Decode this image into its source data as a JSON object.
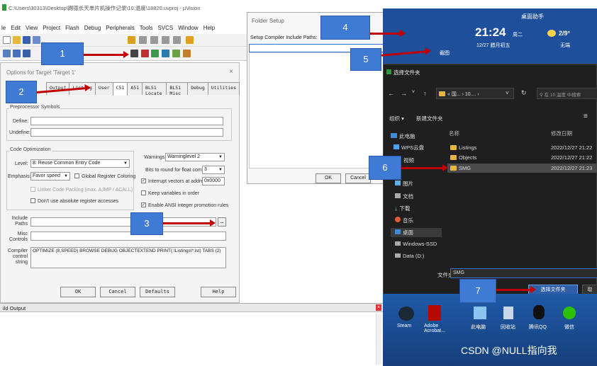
{
  "uvision": {
    "title": "C:\\Users\\30313\\Desktop\\踢德长天单片机操作记录\\10.温度\\18820.uvproj - µVision",
    "menu": [
      "le",
      "Edit",
      "View",
      "Project",
      "Flash",
      "Debug",
      "Peripherals",
      "Tools",
      "SVCS",
      "Window",
      "Help"
    ]
  },
  "options": {
    "title": "Options for Target 'Target 1'",
    "tabs": [
      "Output",
      "Listing",
      "User",
      "C51",
      "A51",
      "BL51 Locate",
      "BL51 Misc",
      "Debug",
      "Utilities"
    ],
    "preproc_label": "Preprocessor Symbols",
    "define_label": "Define:",
    "undefine_label": "Undefine:",
    "codeopt_label": "Code Optimization",
    "level_label": "Level:",
    "level_value": "8: Reuse Common Entry Code",
    "emphasis_label": "Emphasis:",
    "emphasis_value": "Favor speed",
    "global_reg": "Global Register Coloring",
    "linker_pack": "Linker Code Packing (max. AJMP / ACALL)",
    "no_abs": "Don't use absolute register accesses",
    "warnings_label": "Warnings:",
    "warnings_value": "Warninglevel 2",
    "bits_label": "Bits to round for float compare:",
    "bits_value": "3",
    "interrupt_label": "Interrupt vectors at address:",
    "interrupt_value": "0x0000",
    "keep_vars": "Keep variables in order",
    "ansi": "Enable ANSI integer promotion rules",
    "include_label": "Include Paths",
    "misc_label": "Misc Controls",
    "compiler_label": "Compiler control string",
    "compiler_value": "OPTIMIZE (8,SPEED) BROWSE DEBUG OBJECTEXTEND PRINT(.\\Listings\\*.lst) TABS (2)",
    "ok": "OK",
    "cancel": "Cancel",
    "defaults": "Defaults",
    "help": "Help"
  },
  "folder_setup": {
    "title": "Folder Setup",
    "question": "?",
    "close": "X",
    "paths_label": "Setup Compiler Include Paths:",
    "ok": "OK",
    "cancel": "Cancel"
  },
  "desktop": {
    "widget_title": "桌面助手",
    "time": "21:24",
    "weekday": "周二",
    "date": "12/27 腊月初五",
    "temp": "2/9°",
    "weather": "无端",
    "partial": "截图"
  },
  "file_chooser": {
    "title": "选择文件夹",
    "path": "« 国... › 10.... ›",
    "search": "在 10.温度 中搜索",
    "organize": "组织 ▾",
    "new_folder": "新建文件夹",
    "col_name": "名称",
    "col_date": "修改日期",
    "sidebar": [
      "此电脑",
      "WPS云盘",
      "视频",
      "图片",
      "文档",
      "下载",
      "音乐",
      "桌面",
      "Windows-SSD",
      "Data (D:)"
    ],
    "folders": [
      {
        "name": "Listings",
        "date": "2022/12/27 21:22"
      },
      {
        "name": "Objects",
        "date": "2022/12/27 21:22"
      },
      {
        "name": "SMG",
        "date": "2022/12/27 21:23"
      }
    ],
    "filename_label": "文件夹:",
    "filename_value": "SMG",
    "select_button": "选择文件夹",
    "cancel_button": "取"
  },
  "taskbar": {
    "icons": [
      "Steam",
      "Adobe Acrobat...",
      "此电脑",
      "回收站",
      "腾讯QQ",
      "微信"
    ]
  },
  "build_output": {
    "title": "ild Output"
  },
  "watermark": "CSDN @NULL指向我",
  "steps": [
    "1",
    "2",
    "3",
    "4",
    "5",
    "6",
    "7"
  ],
  "colors": {
    "badge": "#3f7bd4",
    "arrow": "#c00000",
    "dark": "#1f1f1f"
  }
}
